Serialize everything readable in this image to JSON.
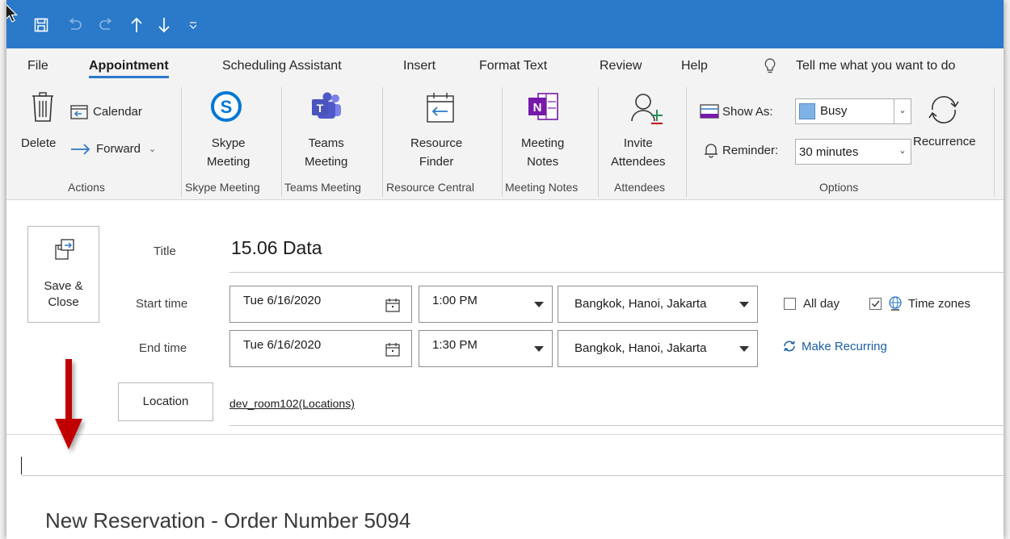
{
  "colors": {
    "accent": "#2b79c9",
    "arrow": "#c00000",
    "link": "#1a5ea8",
    "busy": "#7fb2e5"
  },
  "menu": {
    "tabs": [
      {
        "label": "File"
      },
      {
        "label": "Appointment",
        "active": true
      },
      {
        "label": "Scheduling Assistant"
      },
      {
        "label": "Insert"
      },
      {
        "label": "Format Text"
      },
      {
        "label": "Review"
      },
      {
        "label": "Help"
      }
    ],
    "tell_me": "Tell me what you want to do"
  },
  "ribbon": {
    "actions": {
      "delete": "Delete",
      "calendar": "Calendar",
      "forward": "Forward",
      "group": "Actions"
    },
    "skype": {
      "line1": "Skype",
      "line2": "Meeting",
      "group": "Skype Meeting"
    },
    "teams": {
      "line1": "Teams",
      "line2": "Meeting",
      "group": "Teams Meeting"
    },
    "resource": {
      "line1": "Resource",
      "line2": "Finder",
      "group": "Resource Central"
    },
    "notes": {
      "line1": "Meeting",
      "line2": "Notes",
      "group": "Meeting Notes"
    },
    "invite": {
      "line1": "Invite",
      "line2": "Attendees",
      "group": "Attendees"
    },
    "options": {
      "show_as_label": "Show As:",
      "show_as_value": "Busy",
      "reminder_label": "Reminder:",
      "reminder_value": "30 minutes",
      "recurrence": "Recurrence",
      "group": "Options"
    }
  },
  "form": {
    "save_close": {
      "line1": "Save &",
      "line2": "Close"
    },
    "title_label": "Title",
    "title_value": "15.06 Data",
    "start_label": "Start time",
    "start_date": "Tue 6/16/2020",
    "start_time": "1:00 PM",
    "start_tz": "Bangkok, Hanoi, Jakarta",
    "end_label": "End time",
    "end_date": "Tue 6/16/2020",
    "end_time": "1:30 PM",
    "end_tz": "Bangkok, Hanoi, Jakarta",
    "all_day": {
      "label": "All day",
      "checked": false
    },
    "time_zones": {
      "label": "Time zones",
      "checked": true
    },
    "make_recurring": "Make Recurring",
    "location_button": "Location",
    "location_value": "dev_room102(Locations)"
  },
  "body": {
    "text": "New Reservation - Order Number 5094"
  }
}
